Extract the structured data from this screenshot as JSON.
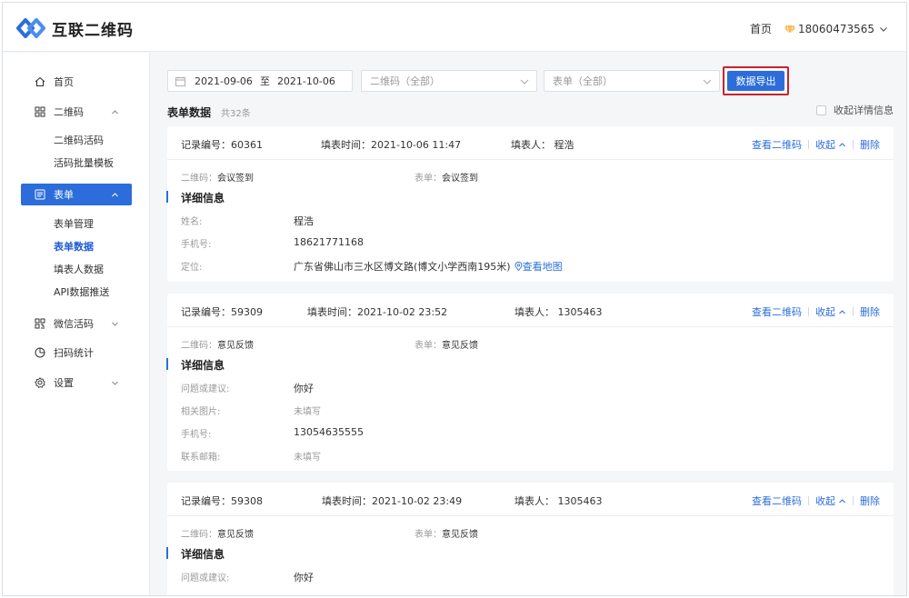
{
  "app": {
    "logo_text": "互联二维码",
    "home_link": "首页",
    "user_phone": "18060473565"
  },
  "sidebar": {
    "items": [
      {
        "label": "首页",
        "icon": "home-icon"
      },
      {
        "label": "二维码",
        "icon": "grid-icon",
        "expanded": true
      },
      {
        "label": "表单",
        "icon": "form-icon",
        "expanded": true,
        "active": true
      },
      {
        "label": "微信活码",
        "icon": "qr-icon",
        "expanded": false
      },
      {
        "label": "扫码统计",
        "icon": "pie-icon"
      },
      {
        "label": "设置",
        "icon": "gear-icon",
        "expanded": false
      }
    ],
    "qrcode_sub": [
      "二维码活码",
      "活码批量模板"
    ],
    "form_sub": [
      "表单管理",
      "表单数据",
      "填表人数据",
      "API数据推送"
    ],
    "active_sub": "表单数据"
  },
  "filters": {
    "date_start": "2021-09-06",
    "date_sep": "至",
    "date_end": "2021-10-06",
    "qrcode_select": "二维码（全部）",
    "form_select": "表单（全部）",
    "export_label": "数据导出"
  },
  "section": {
    "title": "表单数据",
    "count": "共32条",
    "collapse_label": "收起详情信息"
  },
  "labels": {
    "record_no": "记录编号：",
    "fill_time": "填表时间：",
    "filler": "填表人：",
    "view_qr": "查看二维码",
    "collapse": "收起",
    "delete": "删除",
    "qrcode": "二维码：",
    "form": "表单：",
    "detail": "详细信息",
    "view_map": "查看地图"
  },
  "records": [
    {
      "id": "60361",
      "time": "2021-10-06 11:47",
      "filler": "程浩",
      "qrcode": "会议签到",
      "form": "会议签到",
      "fields": [
        {
          "label": "姓名:",
          "value": "程浩"
        },
        {
          "label": "手机号:",
          "value": "18621771168"
        },
        {
          "label": "定位:",
          "value": "广东省佛山市三水区博文路(博文小学西南195米)"
        }
      ]
    },
    {
      "id": "59309",
      "time": "2021-10-02 23:52",
      "filler": "1305463",
      "qrcode": "意见反馈",
      "form": "意见反馈",
      "fields": [
        {
          "label": "问题或建议:",
          "value": "你好"
        },
        {
          "label": "相关图片:",
          "value": "未填写"
        },
        {
          "label": "手机号:",
          "value": "13054635555"
        },
        {
          "label": "联系邮箱:",
          "value": "未填写"
        }
      ]
    },
    {
      "id": "59308",
      "time": "2021-10-02 23:49",
      "filler": "1305463",
      "qrcode": "意见反馈",
      "form": "意见反馈",
      "fields": [
        {
          "label": "问题或建议:",
          "value": "你好"
        }
      ]
    }
  ],
  "colors": {
    "primary": "#2c6ddb",
    "highlight_border": "#c9232b",
    "background": "#f4f6f8"
  }
}
